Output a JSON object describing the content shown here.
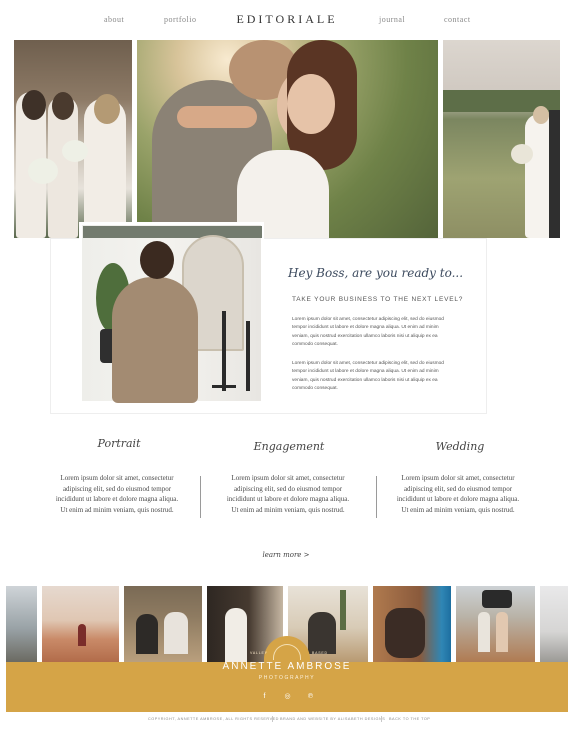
{
  "nav": {
    "links": [
      "about",
      "portfolio",
      "journal",
      "contact"
    ],
    "brand": "EDITORIALE"
  },
  "intro": {
    "heading": "Hey Boss, are you ready to...",
    "subheading": "TAKE YOUR BUSINESS TO THE NEXT LEVEL?",
    "paragraphs": [
      "Lorem ipsum dolor sit amet, consectetur adipiscing elit, sed do eiusmod tempor incididunt ut labore et dolore magna aliqua. Ut enim ad minim veniam, quis nostrud exercitation ullamco laboris nisi ut aliquip ex ea commodo consequat.",
      "Lorem ipsum dolor sit amet, consectetur adipiscing elit, sed do eiusmod tempor incididunt ut labore et dolore magna aliqua. Ut enim ad minim veniam, quis nostrud exercitation ullamco laboris nisi ut aliquip ex ea commodo consequat."
    ]
  },
  "services": {
    "items": [
      {
        "title": "Portrait",
        "text": "Lorem ipsum dolor sit amet, consectetur adipiscing elit, sed do eiusmod tempor incididunt ut labore et dolore magna aliqua. Ut enim ad minim veniam, quis nostrud."
      },
      {
        "title": "Engagement",
        "text": "Lorem ipsum dolor sit amet, consectetur adipiscing elit, sed do eiusmod tempor incididunt ut labore et dolore magna aliqua. Ut enim ad minim veniam, quis nostrud."
      },
      {
        "title": "Wedding",
        "text": "Lorem ipsum dolor sit amet, consectetur adipiscing elit, sed do eiusmod tempor incididunt ut labore et dolore magna aliqua. Ut enim ad minim veniam, quis nostrud."
      }
    ],
    "learn_more": "learn more >"
  },
  "footer": {
    "name": "ANNETTE AMBROSE",
    "tagline": "PHOTOGRAPHY",
    "badge_left": "VALLEY",
    "badge_right": "BASED",
    "social": [
      "f",
      "◎",
      "℗"
    ],
    "copyright": "COPYRIGHT, ANNETTE AMBROSE, ALL RIGHTS RESERVED",
    "credit": "BRAND AND WEBSITE BY ALISABETH DESIGNS",
    "back_to_top": "BACK TO THE TOP"
  },
  "colors": {
    "accent": "#d5a447",
    "heading_ink": "#3c4a5e"
  }
}
